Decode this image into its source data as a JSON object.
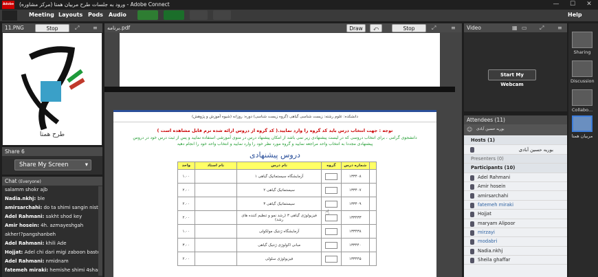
{
  "window": {
    "title": "ورود به جلسات طرح مربیان همتا (مرکز مشاوره) - Adobe Connect",
    "logo_text": "Adobe"
  },
  "menu": {
    "items": [
      "Meeting",
      "Layouts",
      "Pods",
      "Audio"
    ],
    "help": "Help"
  },
  "left_share_pod": {
    "title": "11.PNG",
    "stop_label": "Stop Sharing",
    "logo_text": "طرح همتا"
  },
  "share_pod": {
    "title": "Share 6",
    "button_label": "Share My Screen"
  },
  "chat": {
    "title": "Chat",
    "scope": "(Everyone)",
    "messages": [
      {
        "text": "salamm shokr ajb"
      },
      {
        "name": "Nadia.nkhj:",
        "text": " ble"
      },
      {
        "name": "amirsarchahi:",
        "text": " do ta shimi sangin nist?"
      },
      {
        "name": "Adel Rahmani:",
        "text": " sakht shod key"
      },
      {
        "name": "Amir hosein:",
        "text": " 4h. azmayeshgah"
      },
      {
        "text": "akher!?pangshanbeh"
      },
      {
        "name": "Adel Rahmani:",
        "text": " khili Ade"
      },
      {
        "name": "Hojjat:",
        "text": " Adel chi dari migi zaboon baste"
      },
      {
        "name": "Adel Rahmani:",
        "text": " nmidnam"
      },
      {
        "name": "fatemeh miraki:",
        "text": " hemishe shimi 4shanbebe"
      }
    ]
  },
  "main_pod": {
    "title": "برنامه.pdf",
    "draw_label": "Draw",
    "stop_label": "Stop Sharing"
  },
  "document": {
    "info_row": "دانشکده: علوم     رشته: زیست شناسی گیاهی (گروه زیست شناسی)     دوره: روزانه (شیوه آموزش و پژوهش)",
    "notice_red": "توجه : جهت انتخاب درس باید کد گروه را وارد نمایید.( کد گروه از دروس ارائه شده ترم قابل مشاهده است )",
    "notice_green": "دانشجوی گرامی ، برای انتخاب دروسی که در لیست پیشنهادی زیر نمی باشد از امکان پیشنهاد درس در منوی آموزشی استفاده نمایید و پس از ثبت درس خود در دروس پیشنهادی مجددا به انتخاب واحد مراجعه نمایید و گروه مورد نظر خود را وارد نمایید و انتخاب واحد خود را انجام دهید",
    "heading": "دروس پیشنهادی",
    "columns": [
      "واحد",
      "نام استاد",
      "نام درس",
      "گروه",
      "شماره درس"
    ],
    "rows": [
      {
        "units": "۱.۰۰",
        "course": "آزمایشگاه سیستماتیک گیاهی ۱",
        "code": "۱۳۳۴۰۸"
      },
      {
        "units": "۲.۰۰",
        "course": "سیستماتیک گیاهی ۲",
        "code": "۱۳۳۴۰۷"
      },
      {
        "units": "۲.۰۰",
        "course": "سیستماتیک گیاهی ۳",
        "code": "۱۳۳۴۰۹"
      },
      {
        "units": "۲.۰۰",
        "course": "فیزیولوژی گیاهی ۳ (رشد نمو و تنظیم کننده های رشد)",
        "code": "۱۳۳۴۳۳"
      },
      {
        "units": "۱.۰۰",
        "course": "آزمایشگاه ژنتیک مولکولی",
        "code": "۱۳۳۴۳۸"
      },
      {
        "units": "۳.۰۰",
        "course": "مبانی اکولوژی ژنتیک گیاهی",
        "code": "۱۳۳۴۴۰"
      },
      {
        "units": "۲.۰۰",
        "course": "فیزیولوژی سلولی",
        "code": "۱۳۳۴۴۵"
      }
    ]
  },
  "video_pod": {
    "title": "Video",
    "button_label": "Start My Webcam"
  },
  "attendees": {
    "title": "Attendees",
    "count": "(11)",
    "top_item": "بوریه حسین آبادی",
    "hosts_label": "Hosts (1)",
    "host": "بوریه حسین آبادی",
    "presenters_label": "Presenters (0)",
    "participants_label": "Participants (10)",
    "participants": [
      {
        "name": "Adel Rahmani"
      },
      {
        "name": "Amir hosein"
      },
      {
        "name": "amirsarchahi"
      },
      {
        "name": "fatemeh miraki"
      },
      {
        "name": "Hojjat"
      },
      {
        "name": "maryam Alipoor"
      },
      {
        "name": "mirzayi"
      },
      {
        "name": "modabri"
      },
      {
        "name": "Nadia.nkhj"
      },
      {
        "name": "Sheila ghaffar"
      }
    ]
  },
  "right_bar": {
    "items": [
      "Sharing",
      "Discussion",
      "Collabo...",
      "مربیان همتا"
    ]
  },
  "colors": {
    "accent_red": "#cc0000",
    "doc_blue": "#2a4f9a",
    "green_text": "#1b9a2c",
    "header_yellow": "#ffff66"
  }
}
